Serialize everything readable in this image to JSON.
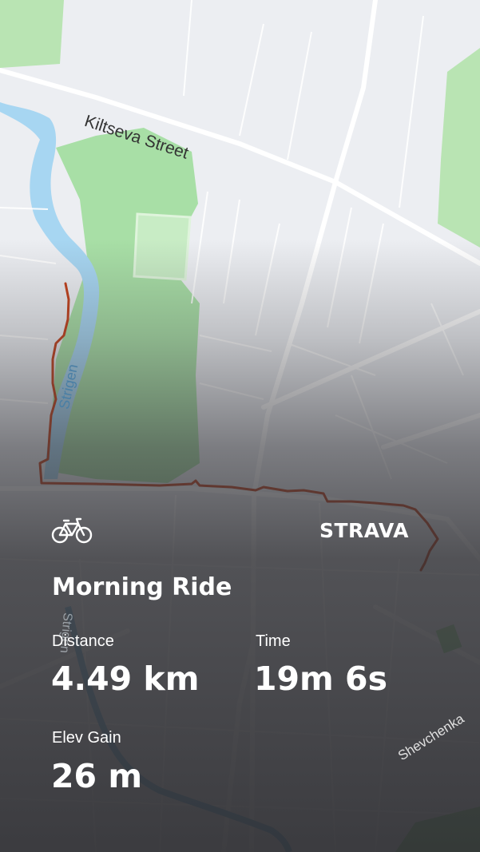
{
  "map": {
    "street_kiltseva": "Kiltseva Street",
    "river_label": "Strigen",
    "river_label_lower": "Strigen",
    "street_shevchenka": "Shevchenka"
  },
  "overlay": {
    "brand": "STRAVA",
    "activity_title": "Morning Ride",
    "stats": {
      "distance_label": "Distance",
      "distance_value": "4.49 km",
      "time_label": "Time",
      "time_value": "19m 6s",
      "elev_label": "Elev Gain",
      "elev_value": "26 m"
    }
  },
  "icons": {
    "activity": "bicycle-icon"
  },
  "colors": {
    "route": "#c2401b",
    "park": "#a8dfa6",
    "water": "#a7d6f2",
    "map_bg": "#eceef2"
  }
}
